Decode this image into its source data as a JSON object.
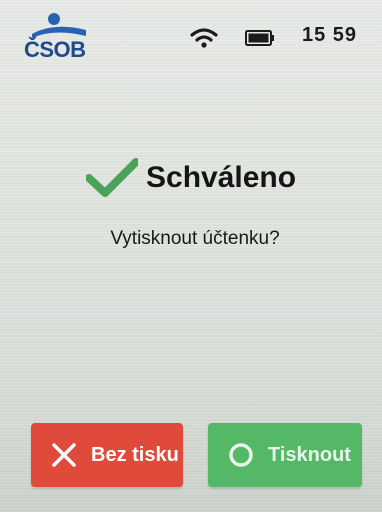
{
  "statusbar": {
    "logo_text": "ČSOB",
    "time": "15 59",
    "icons": [
      "wifi-icon",
      "battery-icon"
    ]
  },
  "main": {
    "status_title": "Schváleno",
    "status_icon": "check-icon",
    "prompt": "Vytisknout účtenku?"
  },
  "actions": {
    "no_label": "Bez tisku",
    "no_icon": "close-icon",
    "yes_label": "Tisknout",
    "yes_icon": "circle-icon"
  },
  "colors": {
    "brand": "#1f4a8c",
    "approved_check": "#4aa35a",
    "cancel_button": "#e04a3b",
    "print_button": "#54b866"
  }
}
